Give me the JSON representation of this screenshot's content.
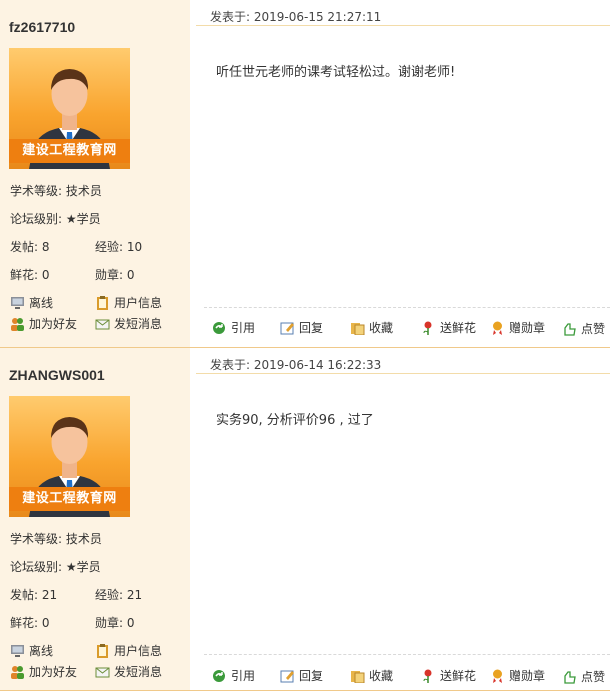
{
  "posts": [
    {
      "username": "fz2617710",
      "avatar_banner": "建设工程教育网",
      "academic_level": "学术等级: 技术员",
      "forum_level": "论坛级别: ★学员",
      "posts_label": "发帖: 8",
      "exp_label": "经验: 10",
      "flowers_label": "鲜花: 0",
      "medals_label": "勋章: 0",
      "status": "离线",
      "user_info": "用户信息",
      "add_friend": "加为好友",
      "send_message": "发短消息",
      "posted_at": "发表于: 2019-06-15 21:27:11",
      "content": "听任世元老师的课考试轻松过。谢谢老师!",
      "actions": {
        "quote": "引用",
        "reply": "回复",
        "favorite": "收藏",
        "flower": "送鲜花",
        "medal": "赠勋章",
        "like": "点赞"
      }
    },
    {
      "username": "ZHANGWS001",
      "avatar_banner": "建设工程教育网",
      "academic_level": "学术等级: 技术员",
      "forum_level": "论坛级别: ★学员",
      "posts_label": "发帖: 21",
      "exp_label": "经验: 21",
      "flowers_label": "鲜花: 0",
      "medals_label": "勋章: 0",
      "status": "离线",
      "user_info": "用户信息",
      "add_friend": "加为好友",
      "send_message": "发短消息",
      "posted_at": "发表于: 2019-06-14 16:22:33",
      "content": "实务90, 分析评价96 , 过了",
      "actions": {
        "quote": "引用",
        "reply": "回复",
        "favorite": "收藏",
        "flower": "送鲜花",
        "medal": "赠勋章",
        "like": "点赞"
      }
    }
  ]
}
